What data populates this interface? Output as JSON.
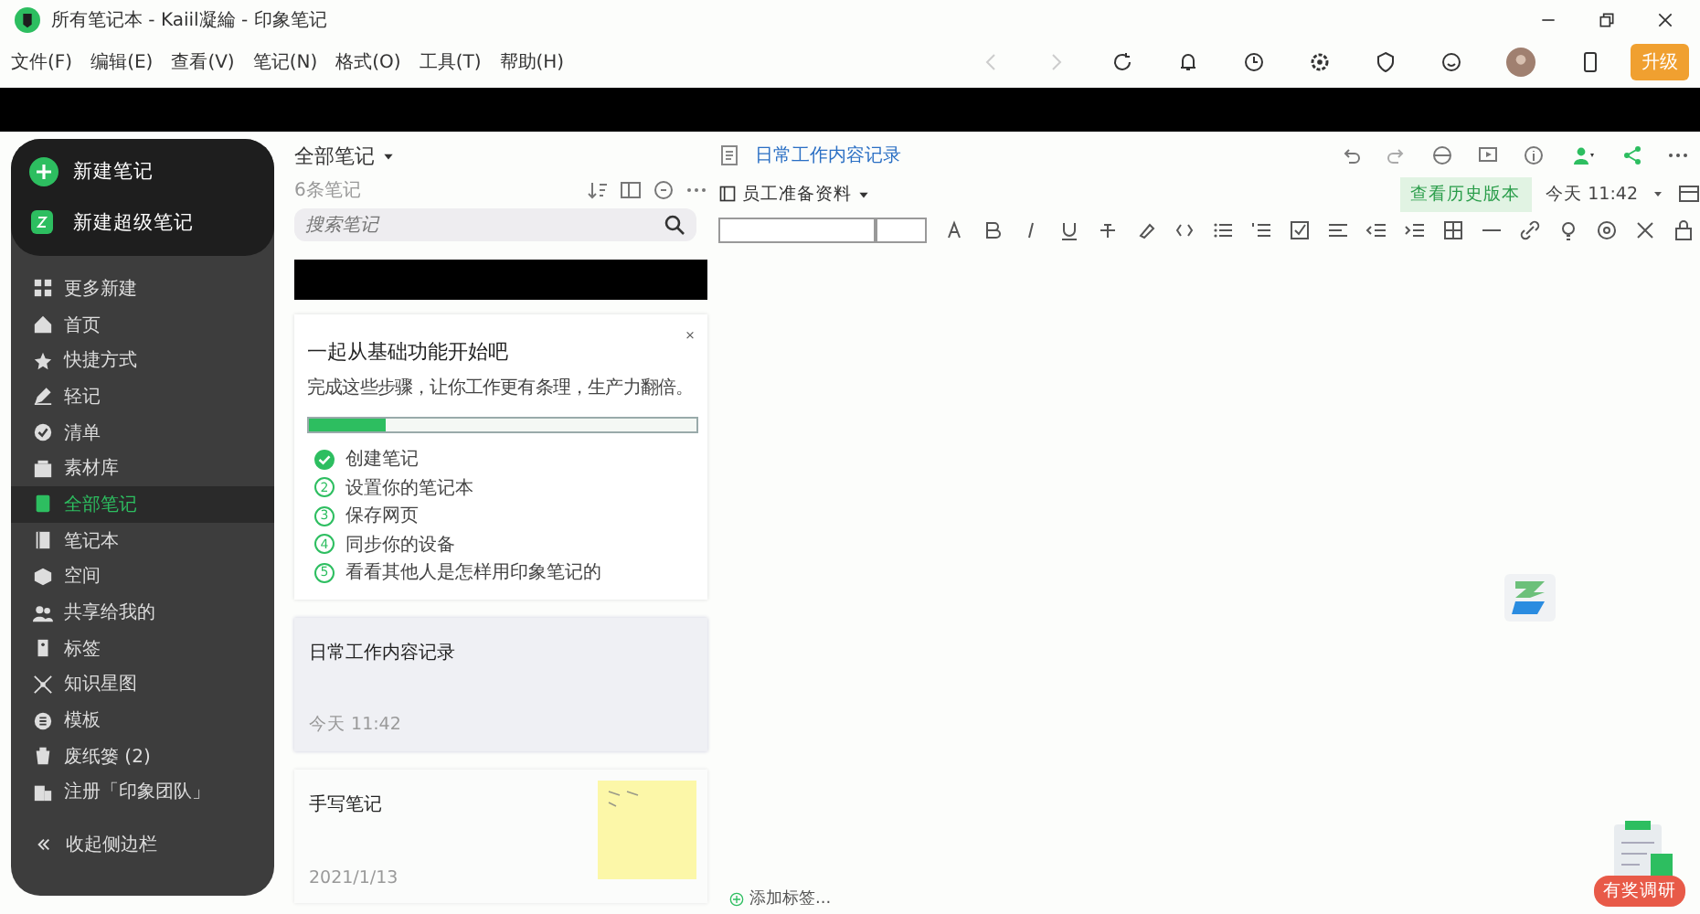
{
  "window": {
    "title": "所有笔记本 - Kaiil凝綸 - 印象笔记"
  },
  "menu": [
    "文件(F)",
    "编辑(E)",
    "查看(V)",
    "笔记(N)",
    "格式(O)",
    "工具(T)",
    "帮助(H)"
  ],
  "upgrade": {
    "label": "升级"
  },
  "sidebar": {
    "new_note": "新建笔记",
    "new_super_note": "新建超级笔记",
    "items": [
      {
        "label": "更多新建",
        "selected": false
      },
      {
        "label": "首页",
        "selected": false
      },
      {
        "label": "快捷方式",
        "selected": false
      },
      {
        "label": "轻记",
        "selected": false
      },
      {
        "label": "清单",
        "selected": false
      },
      {
        "label": "素材库",
        "selected": false
      },
      {
        "label": "全部笔记",
        "selected": true
      },
      {
        "label": "笔记本",
        "selected": false
      },
      {
        "label": "空间",
        "selected": false
      },
      {
        "label": "共享给我的",
        "selected": false
      },
      {
        "label": "标签",
        "selected": false
      },
      {
        "label": "知识星图",
        "selected": false
      },
      {
        "label": "模板",
        "selected": false
      },
      {
        "label": "废纸篓 (2)",
        "selected": false
      },
      {
        "label": "注册「印象团队」",
        "selected": false
      }
    ],
    "collapse": "收起侧边栏"
  },
  "note_list": {
    "title": "全部笔记",
    "count": "6条笔记",
    "search": {
      "placeholder": "搜索笔记"
    },
    "onboarding": {
      "title": "一起从基础功能开始吧",
      "subtitle": "完成这些步骤，让你工作更有条理，生产力翻倍。",
      "level": 0.2,
      "steps": [
        {
          "label": "创建笔记",
          "done": true
        },
        {
          "number": "2",
          "label": "设置你的笔记本",
          "done": false
        },
        {
          "number": "3",
          "label": "保存网页",
          "done": false
        },
        {
          "number": "4",
          "label": "同步你的设备",
          "done": false
        },
        {
          "number": "5",
          "label": "看看其他人是怎样用印象笔记的",
          "done": false
        }
      ]
    },
    "notes": [
      {
        "title": "日常工作内容记录",
        "date": "今天 11:42",
        "selected": true,
        "kind": "text"
      },
      {
        "title": "手写笔记",
        "date": "2021/1/13",
        "selected": false,
        "kind": "handwriting"
      }
    ]
  },
  "editor": {
    "title": "日常工作内容记录",
    "notebook": "员工准备资料",
    "history_button": "查看历史版本",
    "time": "今天 11:42",
    "add_tag": "添加标签..."
  },
  "survey": {
    "label": "有奖调研"
  }
}
